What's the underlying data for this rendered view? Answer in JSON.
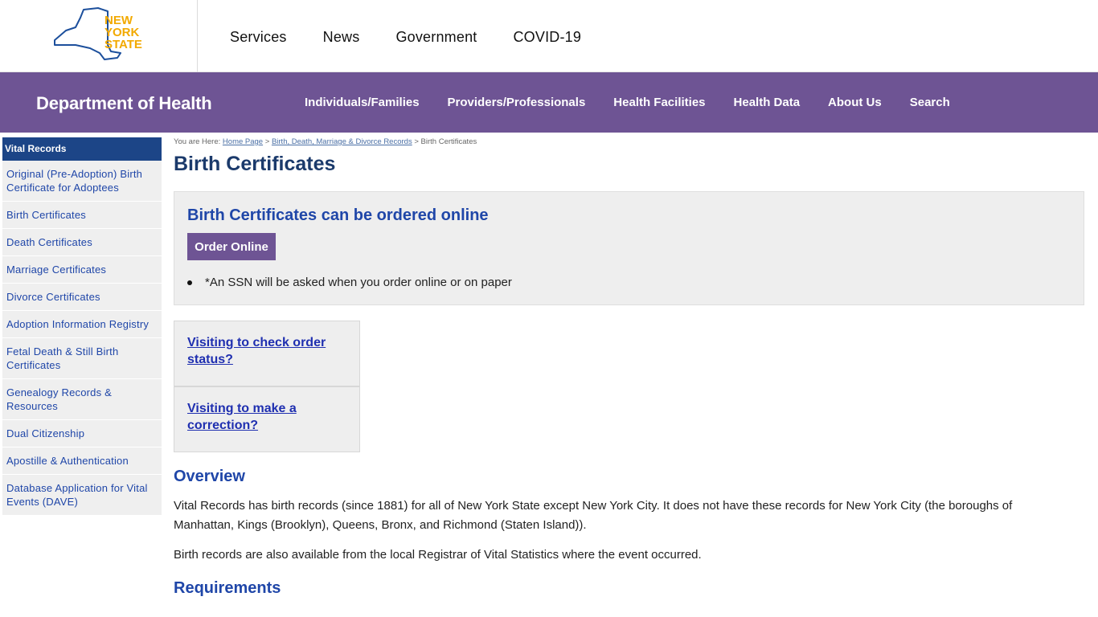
{
  "logo": {
    "lines": [
      "NEW",
      "YORK",
      "STATE"
    ],
    "color": "#f2a900",
    "outline_color": "#1c4f9c"
  },
  "state_nav": [
    "Services",
    "News",
    "Government",
    "COVID-19"
  ],
  "doh": {
    "title": "Department of Health",
    "nav": [
      "Individuals/Families",
      "Providers/Professionals",
      "Health Facilities",
      "Health Data",
      "About Us",
      "Search"
    ],
    "color": "#6e5494"
  },
  "sidebar": {
    "heading": "Vital Records",
    "items": [
      "Original (Pre-Adoption) Birth Certificate for Adoptees",
      "Birth Certificates",
      "Death Certificates",
      "Marriage Certificates",
      "Divorce Certificates",
      "Adoption Information Registry",
      "Fetal Death & Still Birth Certificates",
      "Genealogy Records & Resources",
      "Dual Citizenship",
      "Apostille & Authentication",
      "Database Application for Vital Events (DAVE)"
    ]
  },
  "breadcrumb": {
    "prefix": "You are Here:",
    "links": [
      "Home Page",
      "Birth, Death, Marriage & Divorce Records"
    ],
    "sep": ">",
    "current": "Birth Certificates"
  },
  "page_title": "Birth Certificates",
  "order": {
    "heading": "Birth Certificates can be ordered online",
    "button": "Order Online",
    "note": "*An SSN will be asked when you order online or on paper"
  },
  "visit_links": [
    "Visiting to check order status?",
    "Visiting to make a correction?"
  ],
  "overview": {
    "title": "Overview",
    "p1": "Vital Records has birth records (since 1881) for all of New York State except New York City. It does not have these records for New York City (the boroughs of Manhattan, Kings (Brooklyn), Queens, Bronx, and Richmond (Staten Island)).",
    "p2": "Birth records are also available from the local Registrar of Vital Statistics where the event occurred."
  },
  "requirements_title": "Requirements"
}
